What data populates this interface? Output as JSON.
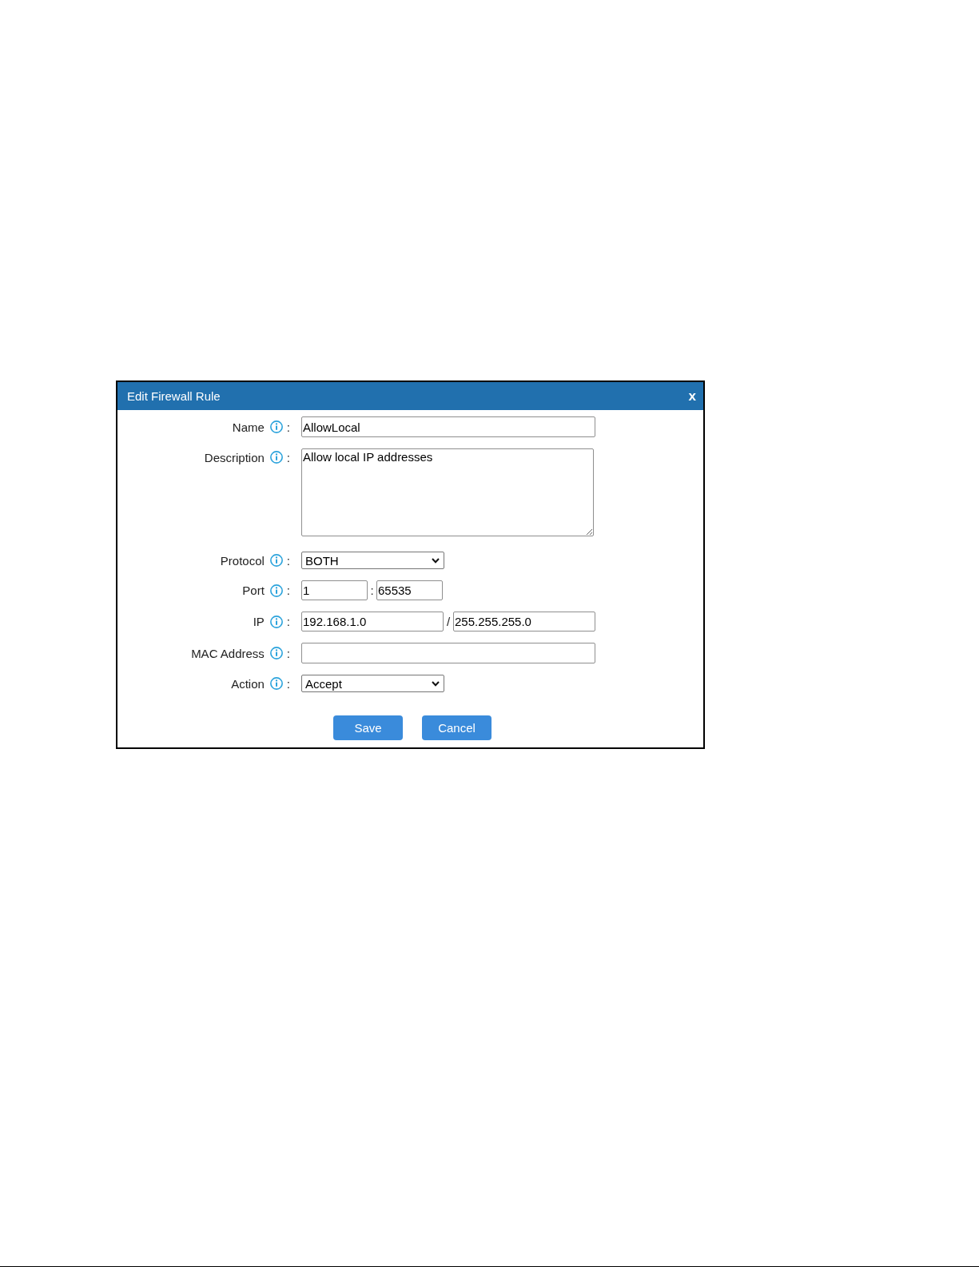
{
  "dialog": {
    "title": "Edit Firewall Rule",
    "close": "x"
  },
  "fields": [
    {
      "kind": "text",
      "label": "Name",
      "suffix": ":",
      "value": "AllowLocal"
    },
    {
      "kind": "textarea",
      "label": "Description",
      "suffix": ":",
      "value": "Allow local IP addresses"
    },
    {
      "kind": "select",
      "label": "Protocol",
      "suffix": ":",
      "value": "BOTH"
    },
    {
      "kind": "range",
      "label": "Port",
      "suffix": ":",
      "values": [
        "1",
        "65535"
      ],
      "joiner": ":"
    },
    {
      "kind": "pair",
      "label": "IP",
      "suffix": ":",
      "values": [
        "192.168.1.0",
        "255.255.255.0"
      ],
      "joiner": "/"
    },
    {
      "kind": "text",
      "label": "MAC Address",
      "suffix": ":"
    },
    {
      "kind": "select",
      "label": "Action",
      "suffix": ":",
      "value": "Accept"
    }
  ],
  "buttons": [
    "Save",
    "Cancel"
  ]
}
